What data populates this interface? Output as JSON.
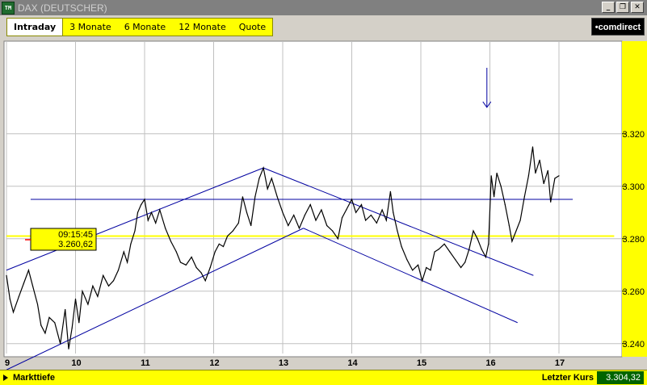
{
  "window": {
    "title": "DAX (DEUTSCHER)",
    "app_icon_text": "TM",
    "buttons": [
      "_",
      "❐",
      "✕"
    ]
  },
  "tabs": [
    {
      "label": "Intraday",
      "active": true
    },
    {
      "label": "3 Monate",
      "active": false
    },
    {
      "label": "6 Monate",
      "active": false
    },
    {
      "label": "12 Monate",
      "active": false
    },
    {
      "label": "Quote",
      "active": false
    }
  ],
  "brand": "•comdirect",
  "footer": {
    "left_label": "Markttiefe",
    "right_label": "Letzter Kurs",
    "last_value": "3.304,32"
  },
  "tooltip": {
    "time": "09:15:45",
    "value": "3.260,62"
  },
  "colors": {
    "accent": "#ffff00",
    "line": "#000000",
    "trendline": "#0000a0",
    "support": "#ffff00",
    "grid": "#c0c0c0"
  },
  "chart_data": {
    "type": "line",
    "x_ticks": [
      "9",
      "10",
      "11",
      "12",
      "13",
      "14",
      "15",
      "16",
      "17"
    ],
    "y_ticks": [
      "3.240",
      "3.260",
      "3.280",
      "3.300",
      "3.320"
    ],
    "ylim": [
      3222,
      3340
    ],
    "xlim": [
      9,
      17.8
    ],
    "series": [
      {
        "values": [
          [
            9.0,
            3266
          ],
          [
            9.05,
            3257
          ],
          [
            9.1,
            3252
          ],
          [
            9.18,
            3258
          ],
          [
            9.25,
            3263
          ],
          [
            9.32,
            3268
          ],
          [
            9.38,
            3262
          ],
          [
            9.45,
            3255
          ],
          [
            9.5,
            3247
          ],
          [
            9.56,
            3244
          ],
          [
            9.62,
            3250
          ],
          [
            9.7,
            3248
          ],
          [
            9.78,
            3240
          ],
          [
            9.85,
            3253
          ],
          [
            9.9,
            3238
          ],
          [
            9.95,
            3246
          ],
          [
            10.0,
            3257
          ],
          [
            10.05,
            3248
          ],
          [
            10.1,
            3260
          ],
          [
            10.18,
            3255
          ],
          [
            10.25,
            3262
          ],
          [
            10.32,
            3258
          ],
          [
            10.4,
            3266
          ],
          [
            10.48,
            3262
          ],
          [
            10.55,
            3264
          ],
          [
            10.62,
            3268
          ],
          [
            10.7,
            3275
          ],
          [
            10.75,
            3271
          ],
          [
            10.8,
            3278
          ],
          [
            10.86,
            3283
          ],
          [
            10.9,
            3290
          ],
          [
            10.95,
            3293
          ],
          [
            11.0,
            3295
          ],
          [
            11.05,
            3287
          ],
          [
            11.1,
            3290
          ],
          [
            11.16,
            3286
          ],
          [
            11.22,
            3291
          ],
          [
            11.3,
            3284
          ],
          [
            11.38,
            3279
          ],
          [
            11.46,
            3275
          ],
          [
            11.52,
            3271
          ],
          [
            11.6,
            3270
          ],
          [
            11.68,
            3273
          ],
          [
            11.75,
            3269
          ],
          [
            11.82,
            3267
          ],
          [
            11.88,
            3264
          ],
          [
            11.95,
            3269
          ],
          [
            12.02,
            3275
          ],
          [
            12.08,
            3278
          ],
          [
            12.14,
            3277
          ],
          [
            12.2,
            3281
          ],
          [
            12.28,
            3283
          ],
          [
            12.36,
            3286
          ],
          [
            12.42,
            3296
          ],
          [
            12.48,
            3290
          ],
          [
            12.54,
            3285
          ],
          [
            12.6,
            3296
          ],
          [
            12.66,
            3303
          ],
          [
            12.72,
            3307
          ],
          [
            12.78,
            3299
          ],
          [
            12.84,
            3303
          ],
          [
            12.92,
            3296
          ],
          [
            13.0,
            3290
          ],
          [
            13.08,
            3285
          ],
          [
            13.16,
            3289
          ],
          [
            13.24,
            3284
          ],
          [
            13.32,
            3289
          ],
          [
            13.4,
            3293
          ],
          [
            13.48,
            3287
          ],
          [
            13.56,
            3291
          ],
          [
            13.64,
            3285
          ],
          [
            13.72,
            3283
          ],
          [
            13.8,
            3280
          ],
          [
            13.86,
            3288
          ],
          [
            13.92,
            3291
          ],
          [
            14.0,
            3295
          ],
          [
            14.06,
            3290
          ],
          [
            14.14,
            3293
          ],
          [
            14.2,
            3287
          ],
          [
            14.28,
            3289
          ],
          [
            14.36,
            3286
          ],
          [
            14.44,
            3291
          ],
          [
            14.5,
            3287
          ],
          [
            14.56,
            3298
          ],
          [
            14.6,
            3290
          ],
          [
            14.66,
            3283
          ],
          [
            14.72,
            3277
          ],
          [
            14.8,
            3272
          ],
          [
            14.88,
            3268
          ],
          [
            14.96,
            3270
          ],
          [
            15.02,
            3264
          ],
          [
            15.08,
            3269
          ],
          [
            15.14,
            3268
          ],
          [
            15.2,
            3275
          ],
          [
            15.26,
            3276
          ],
          [
            15.34,
            3278
          ],
          [
            15.42,
            3275
          ],
          [
            15.5,
            3272
          ],
          [
            15.58,
            3269
          ],
          [
            15.64,
            3271
          ],
          [
            15.7,
            3276
          ],
          [
            15.76,
            3283
          ],
          [
            15.82,
            3280
          ],
          [
            15.88,
            3276
          ],
          [
            15.94,
            3273
          ],
          [
            15.98,
            3278
          ],
          [
            16.02,
            3304
          ],
          [
            16.06,
            3296
          ],
          [
            16.1,
            3305
          ],
          [
            16.16,
            3300
          ],
          [
            16.22,
            3293
          ],
          [
            16.28,
            3285
          ],
          [
            16.32,
            3279
          ],
          [
            16.38,
            3283
          ],
          [
            16.44,
            3287
          ],
          [
            16.5,
            3296
          ],
          [
            16.56,
            3304
          ],
          [
            16.62,
            3315
          ],
          [
            16.66,
            3305
          ],
          [
            16.72,
            3310
          ],
          [
            16.78,
            3301
          ],
          [
            16.84,
            3306
          ],
          [
            16.88,
            3294
          ],
          [
            16.94,
            3303
          ],
          [
            17.0,
            3304
          ]
        ]
      }
    ],
    "reference_lines": [
      {
        "name": "resistance",
        "from": [
          9.35,
          3295
        ],
        "to": [
          17.2,
          3295
        ]
      },
      {
        "name": "support",
        "from": [
          9.0,
          3281
        ],
        "to": [
          17.8,
          3281
        ]
      }
    ],
    "trendlines": [
      {
        "from": [
          9.0,
          3230
        ],
        "to": [
          13.3,
          3284
        ]
      },
      {
        "from": [
          9.0,
          3268
        ],
        "to": [
          12.72,
          3307
        ]
      },
      {
        "from": [
          12.72,
          3307
        ],
        "to": [
          16.63,
          3266
        ]
      },
      {
        "from": [
          13.3,
          3284
        ],
        "to": [
          16.4,
          3248
        ]
      }
    ]
  }
}
